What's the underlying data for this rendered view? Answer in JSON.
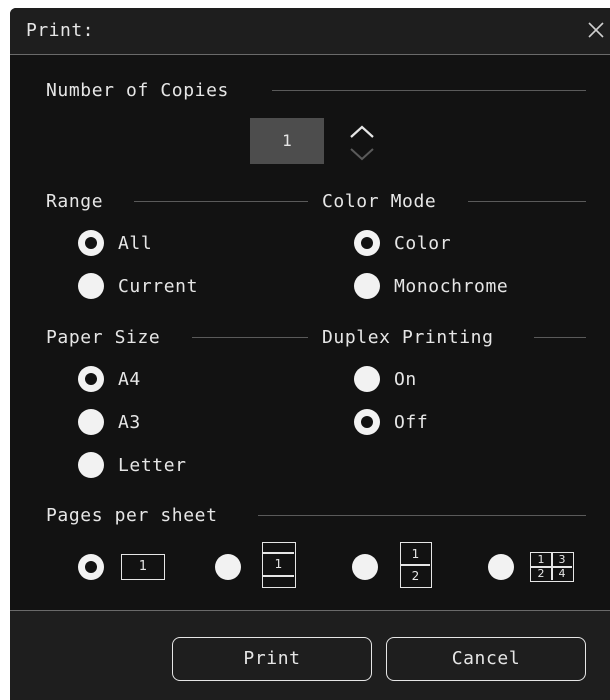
{
  "dialog": {
    "title": "Print:"
  },
  "copies": {
    "label": "Number of Copies",
    "value": "1"
  },
  "range": {
    "label": "Range",
    "options": [
      {
        "label": "All",
        "checked": true
      },
      {
        "label": "Current",
        "checked": false
      }
    ]
  },
  "color_mode": {
    "label": "Color Mode",
    "options": [
      {
        "label": "Color",
        "checked": true
      },
      {
        "label": "Monochrome",
        "checked": false
      }
    ]
  },
  "paper_size": {
    "label": "Paper Size",
    "options": [
      {
        "label": "A4",
        "checked": true
      },
      {
        "label": "A3",
        "checked": false
      },
      {
        "label": "Letter",
        "checked": false
      }
    ]
  },
  "duplex": {
    "label": "Duplex Printing",
    "options": [
      {
        "label": "On",
        "checked": false
      },
      {
        "label": "Off",
        "checked": true
      }
    ]
  },
  "pages_per_sheet": {
    "label": "Pages per sheet",
    "options": [
      {
        "icon": "one-page-icon",
        "numbers": [
          "1"
        ],
        "checked": true
      },
      {
        "icon": "one-page-with-margins-icon",
        "numbers": [
          "1"
        ],
        "checked": false
      },
      {
        "icon": "two-pages-icon",
        "numbers": [
          "1",
          "2"
        ],
        "checked": false
      },
      {
        "icon": "four-pages-icon",
        "numbers": [
          "1",
          "3",
          "2",
          "4"
        ],
        "checked": false
      }
    ]
  },
  "buttons": {
    "print": "Print",
    "cancel": "Cancel"
  }
}
